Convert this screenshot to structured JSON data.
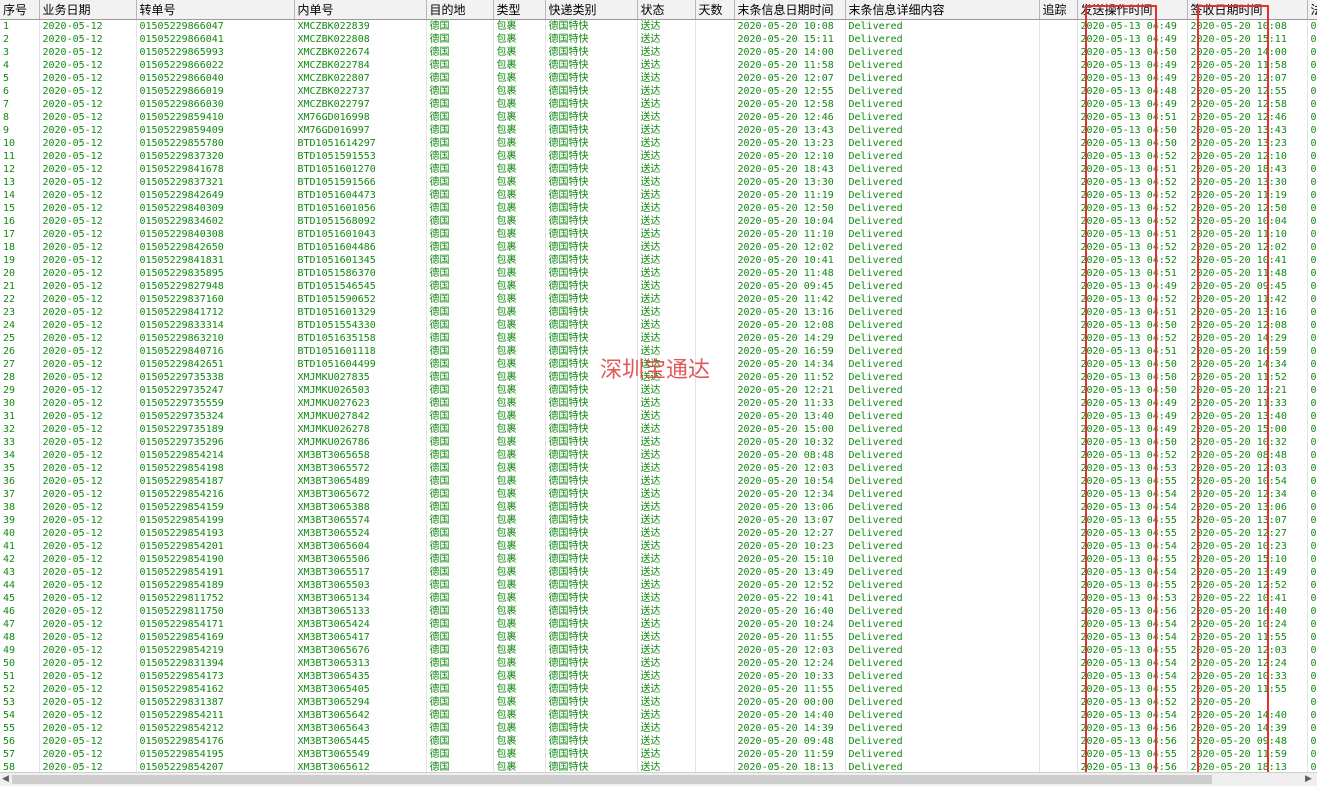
{
  "columns": [
    "序号",
    "业务日期",
    "转单号",
    "内单号",
    "目的地",
    "类型",
    "快递类别",
    "状态",
    "天数",
    "末条信息日期时间",
    "末条信息详细内容",
    "追踪",
    "发送操作时间",
    "签收日期时间",
    "法"
  ],
  "defaults": {
    "business_date": "2020-05-12",
    "destination": "德国",
    "type": "包裹",
    "express": "德国特快",
    "status": "送达",
    "detail": "Delivered",
    "send_date": "2020-05-13",
    "sign_date": "2020-05-20"
  },
  "watermark": "深圳宝通达",
  "rows": [
    {
      "no": "1",
      "transfer": "01505229866047",
      "inner": "XMCZBK022839",
      "last": "2020-05-20 10:08",
      "send_time": "04:49",
      "sign_time": "10:08",
      "extra": "0"
    },
    {
      "no": "2",
      "transfer": "01505229866041",
      "inner": "XMCZBK022808",
      "last": "2020-05-20 15:11",
      "send_time": "04:49",
      "sign_time": "15:11",
      "extra": "0"
    },
    {
      "no": "3",
      "transfer": "01505229865993",
      "inner": "XMCZBK022674",
      "last": "2020-05-20 14:00",
      "send_time": "04:50",
      "sign_time": "14:00",
      "extra": "0"
    },
    {
      "no": "4",
      "transfer": "01505229866022",
      "inner": "XMCZBK022784",
      "last": "2020-05-20 11:58",
      "send_time": "04:49",
      "sign_time": "11:58",
      "extra": "0"
    },
    {
      "no": "5",
      "transfer": "01505229866040",
      "inner": "XMCZBK022807",
      "last": "2020-05-20 12:07",
      "send_time": "04:49",
      "sign_time": "12:07",
      "extra": "0"
    },
    {
      "no": "6",
      "transfer": "01505229866019",
      "inner": "XMCZBK022737",
      "last": "2020-05-20 12:55",
      "send_time": "04:48",
      "sign_time": "12:55",
      "extra": "0"
    },
    {
      "no": "7",
      "transfer": "01505229866030",
      "inner": "XMCZBK022797",
      "last": "2020-05-20 12:58",
      "send_time": "04:49",
      "sign_time": "12:58",
      "extra": "0"
    },
    {
      "no": "8",
      "transfer": "01505229859410",
      "inner": "XM76GD016998",
      "last": "2020-05-20 12:46",
      "send_time": "04:51",
      "sign_time": "12:46",
      "extra": "0"
    },
    {
      "no": "9",
      "transfer": "01505229859409",
      "inner": "XM76GD016997",
      "last": "2020-05-20 13:43",
      "send_time": "04:50",
      "sign_time": "13:43",
      "extra": "0"
    },
    {
      "no": "10",
      "transfer": "01505229855780",
      "inner": "BTD1051614297",
      "last": "2020-05-20 13:23",
      "send_time": "04:50",
      "sign_time": "13:23",
      "extra": "0"
    },
    {
      "no": "11",
      "transfer": "01505229837320",
      "inner": "BTD1051591553",
      "last": "2020-05-20 12:10",
      "send_time": "04:52",
      "sign_time": "12:10",
      "extra": "0"
    },
    {
      "no": "12",
      "transfer": "01505229841678",
      "inner": "BTD1051601270",
      "last": "2020-05-20 18:43",
      "send_time": "04:51",
      "sign_time": "18:43",
      "extra": "0"
    },
    {
      "no": "13",
      "transfer": "01505229837321",
      "inner": "BTD1051591566",
      "last": "2020-05-20 13:30",
      "send_time": "04:52",
      "sign_time": "13:30",
      "extra": "0"
    },
    {
      "no": "14",
      "transfer": "01505229842649",
      "inner": "BTD1051604473",
      "last": "2020-05-20 11:19",
      "send_time": "04:52",
      "sign_time": "11:19",
      "extra": "0"
    },
    {
      "no": "15",
      "transfer": "01505229840309",
      "inner": "BTD1051601056",
      "last": "2020-05-20 12:50",
      "send_time": "04:52",
      "sign_time": "12:50",
      "extra": "0"
    },
    {
      "no": "16",
      "transfer": "01505229834602",
      "inner": "BTD1051568092",
      "last": "2020-05-20 10:04",
      "send_time": "04:52",
      "sign_time": "10:04",
      "extra": "0"
    },
    {
      "no": "17",
      "transfer": "01505229840308",
      "inner": "BTD1051601043",
      "last": "2020-05-20 11:10",
      "send_time": "04:51",
      "sign_time": "11:10",
      "extra": "0"
    },
    {
      "no": "18",
      "transfer": "01505229842650",
      "inner": "BTD1051604486",
      "last": "2020-05-20 12:02",
      "send_time": "04:52",
      "sign_time": "12:02",
      "extra": "0"
    },
    {
      "no": "19",
      "transfer": "01505229841831",
      "inner": "BTD1051601345",
      "last": "2020-05-20 10:41",
      "send_time": "04:52",
      "sign_time": "10:41",
      "extra": "0"
    },
    {
      "no": "20",
      "transfer": "01505229835895",
      "inner": "BTD1051586370",
      "last": "2020-05-20 11:48",
      "send_time": "04:51",
      "sign_time": "11:48",
      "extra": "0"
    },
    {
      "no": "21",
      "transfer": "01505229827948",
      "inner": "BTD1051546545",
      "last": "2020-05-20 09:45",
      "send_time": "04:49",
      "sign_time": "09:45",
      "extra": "0"
    },
    {
      "no": "22",
      "transfer": "01505229837160",
      "inner": "BTD1051590652",
      "last": "2020-05-20 11:42",
      "send_time": "04:52",
      "sign_time": "11:42",
      "extra": "0"
    },
    {
      "no": "23",
      "transfer": "01505229841712",
      "inner": "BTD1051601329",
      "last": "2020-05-20 13:16",
      "send_time": "04:51",
      "sign_time": "13:16",
      "extra": "0"
    },
    {
      "no": "24",
      "transfer": "01505229833314",
      "inner": "BTD1051554330",
      "last": "2020-05-20 12:08",
      "send_time": "04:50",
      "sign_time": "12:08",
      "extra": "0"
    },
    {
      "no": "25",
      "transfer": "01505229863210",
      "inner": "BTD1051635158",
      "last": "2020-05-20 14:29",
      "send_time": "04:52",
      "sign_time": "14:29",
      "extra": "0"
    },
    {
      "no": "26",
      "transfer": "01505229840716",
      "inner": "BTD1051601118",
      "last": "2020-05-20 16:59",
      "send_time": "04:51",
      "sign_time": "16:59",
      "extra": "0"
    },
    {
      "no": "27",
      "transfer": "01505229842651",
      "inner": "BTD1051604499",
      "last": "2020-05-20 14:34",
      "send_time": "04:50",
      "sign_time": "14:34",
      "extra": "0"
    },
    {
      "no": "28",
      "transfer": "01505229735338",
      "inner": "XMJMKU027835",
      "last": "2020-05-20 11:52",
      "send_time": "04:50",
      "sign_time": "11:52",
      "extra": "0"
    },
    {
      "no": "29",
      "transfer": "01505229735247",
      "inner": "XMJMKU026503",
      "last": "2020-05-20 12:21",
      "send_time": "04:50",
      "sign_time": "12:21",
      "extra": "0"
    },
    {
      "no": "30",
      "transfer": "01505229735559",
      "inner": "XMJMKU027623",
      "last": "2020-05-20 11:33",
      "send_time": "04:49",
      "sign_time": "11:33",
      "extra": "0"
    },
    {
      "no": "31",
      "transfer": "01505229735324",
      "inner": "XMJMKU027842",
      "last": "2020-05-20 13:40",
      "send_time": "04:49",
      "sign_time": "13:40",
      "extra": "0"
    },
    {
      "no": "32",
      "transfer": "01505229735189",
      "inner": "XMJMKU026278",
      "last": "2020-05-20 15:00",
      "send_time": "04:49",
      "sign_time": "15:00",
      "extra": "0"
    },
    {
      "no": "33",
      "transfer": "01505229735296",
      "inner": "XMJMKU026786",
      "last": "2020-05-20 10:32",
      "send_time": "04:50",
      "sign_time": "10:32",
      "extra": "0"
    },
    {
      "no": "34",
      "transfer": "01505229854214",
      "inner": "XM3BT3065658",
      "last": "2020-05-20 08:48",
      "send_time": "04:52",
      "sign_time": "08:48",
      "extra": "0"
    },
    {
      "no": "35",
      "transfer": "01505229854198",
      "inner": "XM3BT3065572",
      "last": "2020-05-20 12:03",
      "send_time": "04:53",
      "sign_time": "12:03",
      "extra": "0"
    },
    {
      "no": "36",
      "transfer": "01505229854187",
      "inner": "XM3BT3065489",
      "last": "2020-05-20 10:54",
      "send_time": "04:55",
      "sign_time": "10:54",
      "extra": "0"
    },
    {
      "no": "37",
      "transfer": "01505229854216",
      "inner": "XM3BT3065672",
      "last": "2020-05-20 12:34",
      "send_time": "04:54",
      "sign_time": "12:34",
      "extra": "0"
    },
    {
      "no": "38",
      "transfer": "01505229854159",
      "inner": "XM3BT3065388",
      "last": "2020-05-20 13:06",
      "send_time": "04:54",
      "sign_time": "13:06",
      "extra": "0"
    },
    {
      "no": "39",
      "transfer": "01505229854199",
      "inner": "XM3BT3065574",
      "last": "2020-05-20 13:07",
      "send_time": "04:55",
      "sign_time": "13:07",
      "extra": "0"
    },
    {
      "no": "40",
      "transfer": "01505229854193",
      "inner": "XM3BT3065524",
      "last": "2020-05-20 12:27",
      "send_time": "04:55",
      "sign_time": "12:27",
      "extra": "0"
    },
    {
      "no": "41",
      "transfer": "01505229854201",
      "inner": "XM3BT3065604",
      "last": "2020-05-20 10:23",
      "send_time": "04:54",
      "sign_time": "10:23",
      "extra": "0"
    },
    {
      "no": "42",
      "transfer": "01505229854190",
      "inner": "XM3BT3065506",
      "last": "2020-05-20 15:10",
      "send_time": "04:55",
      "sign_time": "15:10",
      "extra": "0"
    },
    {
      "no": "43",
      "transfer": "01505229854191",
      "inner": "XM3BT3065517",
      "last": "2020-05-20 13:49",
      "send_time": "04:54",
      "sign_time": "13:49",
      "extra": "0"
    },
    {
      "no": "44",
      "transfer": "01505229854189",
      "inner": "XM3BT3065503",
      "last": "2020-05-20 12:52",
      "send_time": "04:55",
      "sign_time": "12:52",
      "extra": "0"
    },
    {
      "no": "45",
      "transfer": "01505229811752",
      "inner": "XM3BT3065134",
      "last": "2020-05-22 10:41",
      "send_time": "04:53",
      "sign_date": "2020-05-22",
      "sign_time": "10:41",
      "extra": "0"
    },
    {
      "no": "46",
      "transfer": "01505229811750",
      "inner": "XM3BT3065133",
      "last": "2020-05-20 16:40",
      "send_time": "04:56",
      "sign_time": "16:40",
      "extra": "0"
    },
    {
      "no": "47",
      "transfer": "01505229854171",
      "inner": "XM3BT3065424",
      "last": "2020-05-20 10:24",
      "send_time": "04:54",
      "sign_time": "10:24",
      "extra": "0"
    },
    {
      "no": "48",
      "transfer": "01505229854169",
      "inner": "XM3BT3065417",
      "last": "2020-05-20 11:55",
      "send_time": "04:54",
      "sign_time": "11:55",
      "extra": "0"
    },
    {
      "no": "49",
      "transfer": "01505229854219",
      "inner": "XM3BT3065676",
      "last": "2020-05-20 12:03",
      "send_time": "04:55",
      "sign_time": "12:03",
      "extra": "0"
    },
    {
      "no": "50",
      "transfer": "01505229831394",
      "inner": "XM3BT3065313",
      "last": "2020-05-20 12:24",
      "send_time": "04:54",
      "sign_time": "12:24",
      "extra": "0"
    },
    {
      "no": "51",
      "transfer": "01505229854173",
      "inner": "XM3BT3065435",
      "last": "2020-05-20 10:33",
      "send_time": "04:54",
      "sign_time": "10:33",
      "extra": "0"
    },
    {
      "no": "52",
      "transfer": "01505229854162",
      "inner": "XM3BT3065405",
      "last": "2020-05-20 11:55",
      "send_time": "04:55",
      "sign_time": "11:55",
      "extra": "0"
    },
    {
      "no": "53",
      "transfer": "01505229831387",
      "inner": "XM3BT3065294",
      "last": "2020-05-20 00:00",
      "send_time": "04:52",
      "sign_time": "",
      "extra": "0"
    },
    {
      "no": "54",
      "transfer": "01505229854211",
      "inner": "XM3BT3065642",
      "last": "2020-05-20 14:40",
      "send_time": "04:54",
      "sign_time": "14:40",
      "extra": "0"
    },
    {
      "no": "55",
      "transfer": "01505229854212",
      "inner": "XM3BT3065643",
      "last": "2020-05-20 14:39",
      "send_time": "04:56",
      "sign_time": "14:39",
      "extra": "0"
    },
    {
      "no": "56",
      "transfer": "01505229854176",
      "inner": "XM3BT3065445",
      "last": "2020-05-20 09:48",
      "send_time": "04:56",
      "sign_time": "09:48",
      "extra": "0"
    },
    {
      "no": "57",
      "transfer": "01505229854195",
      "inner": "XM3BT3065549",
      "last": "2020-05-20 11:59",
      "send_time": "04:55",
      "sign_time": "11:59",
      "extra": "0"
    },
    {
      "no": "58",
      "transfer": "01505229854207",
      "inner": "XM3BT3065612",
      "last": "2020-05-20 18:13",
      "send_time": "04:56",
      "sign_time": "18:13",
      "extra": "0"
    }
  ]
}
